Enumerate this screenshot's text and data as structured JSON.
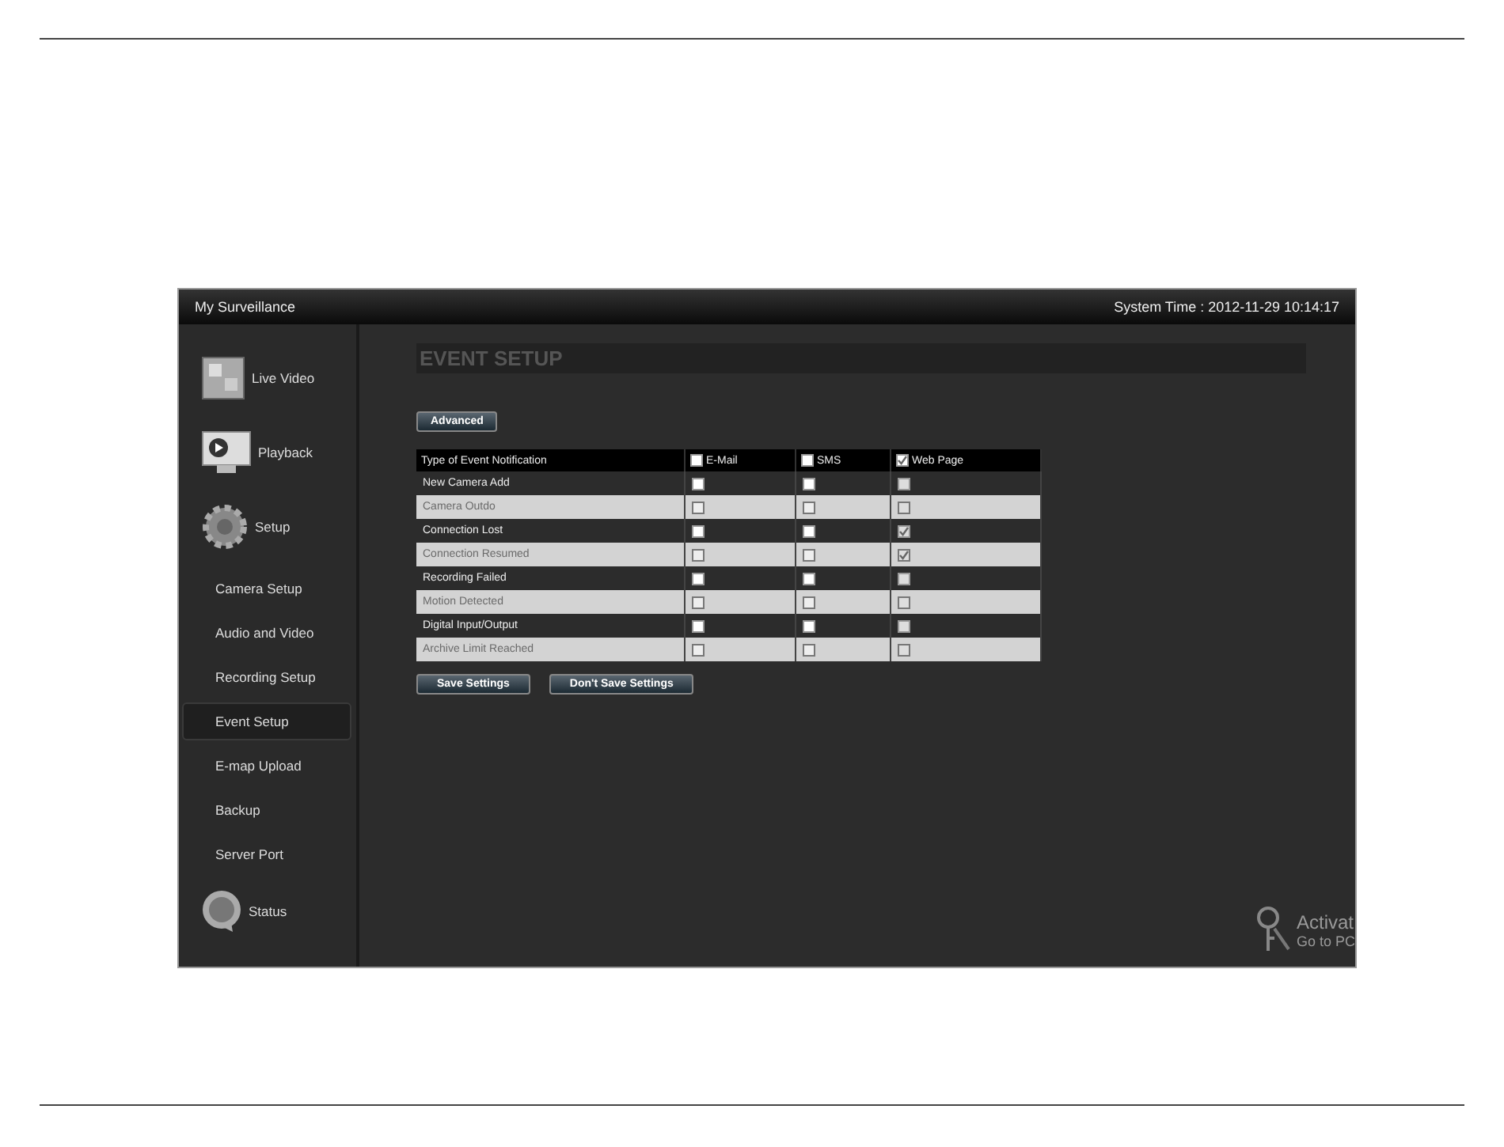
{
  "window": {
    "title": "My Surveillance",
    "system_time": "System Time : 2012-11-29 10:14:17"
  },
  "sidebar": {
    "sections": [
      {
        "label": "Live Video",
        "kind": "video"
      },
      {
        "label": "Playback",
        "kind": "monitor"
      },
      {
        "label": "Setup",
        "kind": "gear",
        "items": [
          {
            "label": "Camera Setup",
            "selected": false
          },
          {
            "label": "Audio and Video",
            "selected": false
          },
          {
            "label": "Recording Setup",
            "selected": false
          },
          {
            "label": "Event Setup",
            "selected": true
          },
          {
            "label": "E-map Upload",
            "selected": false
          },
          {
            "label": "Backup",
            "selected": false
          },
          {
            "label": "Server Port",
            "selected": false
          }
        ]
      },
      {
        "label": "Status",
        "kind": "status"
      }
    ]
  },
  "page": {
    "heading": "EVENT SETUP",
    "advanced_button": "Advanced",
    "table": {
      "heading": "Type of Event Notification",
      "columns": [
        {
          "label": "E-Mail",
          "checked": false,
          "locked": false
        },
        {
          "label": "SMS",
          "checked": false,
          "locked": false
        },
        {
          "label": "Web Page",
          "checked": true,
          "locked": true
        }
      ],
      "rows": [
        {
          "label": "New Camera Add",
          "disabled": false,
          "checks": [
            false,
            false,
            false
          ]
        },
        {
          "label": "Camera Outdo",
          "disabled": true,
          "checks": [
            false,
            false,
            false
          ]
        },
        {
          "label": "Connection Lost",
          "disabled": false,
          "checks": [
            false,
            false,
            true
          ]
        },
        {
          "label": "Connection Resumed",
          "disabled": true,
          "checks": [
            false,
            false,
            true
          ]
        },
        {
          "label": "Recording Failed",
          "disabled": false,
          "checks": [
            false,
            false,
            false
          ]
        },
        {
          "label": "Motion Detected",
          "disabled": true,
          "checks": [
            false,
            false,
            false
          ]
        },
        {
          "label": "Digital Input/Output",
          "disabled": false,
          "checks": [
            false,
            false,
            false
          ]
        },
        {
          "label": "Archive Limit Reached",
          "disabled": true,
          "checks": [
            false,
            false,
            false
          ]
        }
      ]
    },
    "buttons": [
      "Save Settings",
      "Don't Save Settings"
    ]
  },
  "activation_notice": {
    "title": "Activat",
    "subtitle": "Go to PC"
  }
}
